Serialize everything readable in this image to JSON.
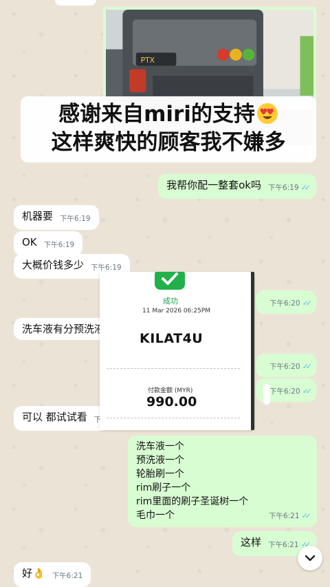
{
  "photo": {
    "brand_text": "PTX"
  },
  "caption": {
    "line1": "感谢来自miri的支持",
    "line2": "这样爽快的顾客我不嫌多",
    "emoji_icon": "heart-eyes-emoji"
  },
  "messages": [
    {
      "dir": "out",
      "text": "我帮你配一整套ok吗",
      "time": "下午6:19",
      "ticks": "✓✓"
    },
    {
      "dir": "in",
      "text": "机器要",
      "time": "下午6:19"
    },
    {
      "dir": "in",
      "text": "OK",
      "time": "下午6:19"
    },
    {
      "dir": "in",
      "text": "大概价钱多少",
      "time": "下午6:19"
    },
    {
      "dir": "out",
      "text": "",
      "time": "下午6:20",
      "ticks": "✓✓"
    },
    {
      "dir": "in",
      "text": "洗车液有分预洗液",
      "time": ""
    },
    {
      "dir": "out",
      "text": "",
      "time": "下午6:20",
      "ticks": "✓✓"
    },
    {
      "dir": "out",
      "text": "",
      "time": "下午6:20",
      "ticks": "✓✓"
    },
    {
      "dir": "in",
      "text": "可以 都试试看",
      "time": "下午6:20"
    },
    {
      "dir": "out",
      "text": "这样",
      "time": "下午6:21",
      "ticks": "✓✓"
    },
    {
      "dir": "in",
      "text": "好👌",
      "time": "下午6:21"
    }
  ],
  "receipt": {
    "status": "成功",
    "datetime": "11 Mar 2026 06:25PM",
    "merchant": "KILAT4U",
    "amount_label": "付款金额 (MYR)",
    "amount": "990.00"
  },
  "list_message": {
    "lines": [
      "洗车液一个",
      "预洗液一个",
      "轮胎刷一个",
      "rim刷子一个",
      "rim里面的刷子圣诞树一个",
      "毛巾一个"
    ],
    "time": "下午6:21",
    "ticks": "✓✓"
  },
  "colors": {
    "incoming_bubble": "#ffffff",
    "outgoing_bubble": "#d9fdd3",
    "read_ticks": "#53bdeb",
    "success_green": "#17a34a",
    "wallpaper": "#ebe4d6"
  },
  "icons": {
    "scroll_down": "chevron-down-icon",
    "receipt_check": "check-icon"
  }
}
